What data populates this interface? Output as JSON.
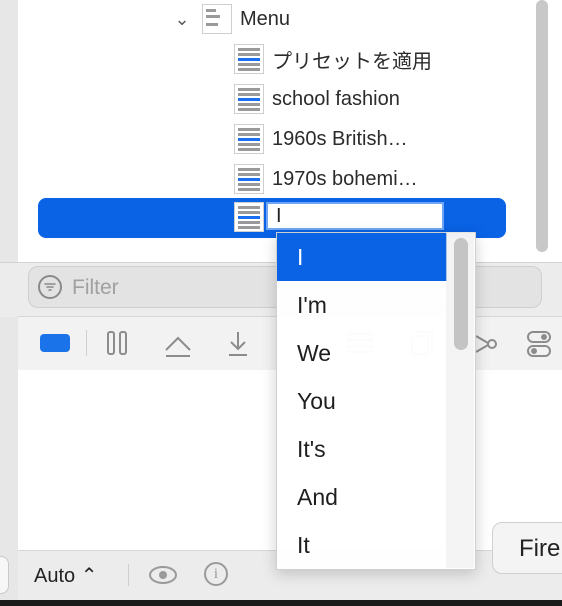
{
  "outline": {
    "parent": {
      "label": "Menu",
      "expanded": true
    },
    "items": [
      {
        "label": "プリセットを適用"
      },
      {
        "label": "school fashion"
      },
      {
        "label": "1960s British…"
      },
      {
        "label": "1970s bohemi…"
      }
    ],
    "editing_value": "I"
  },
  "filter": {
    "placeholder": "Filter"
  },
  "bottom": {
    "mode_select": "Auto ⌃",
    "tooltip_text": "Fire"
  },
  "autocomplete": {
    "suggestions": [
      "I",
      "I'm",
      "We",
      "You",
      "It's",
      "And",
      "It"
    ],
    "selected_index": 0
  },
  "colors": {
    "accent": "#0a62e5",
    "tag": "#1a73e8"
  },
  "icons": [
    "filter-icon",
    "tag-icon",
    "pause-icon",
    "move-up-icon",
    "download-icon",
    "stack-icon",
    "share-icon",
    "toggle-icon",
    "eye-icon",
    "info-icon",
    "chevron-down-icon"
  ]
}
